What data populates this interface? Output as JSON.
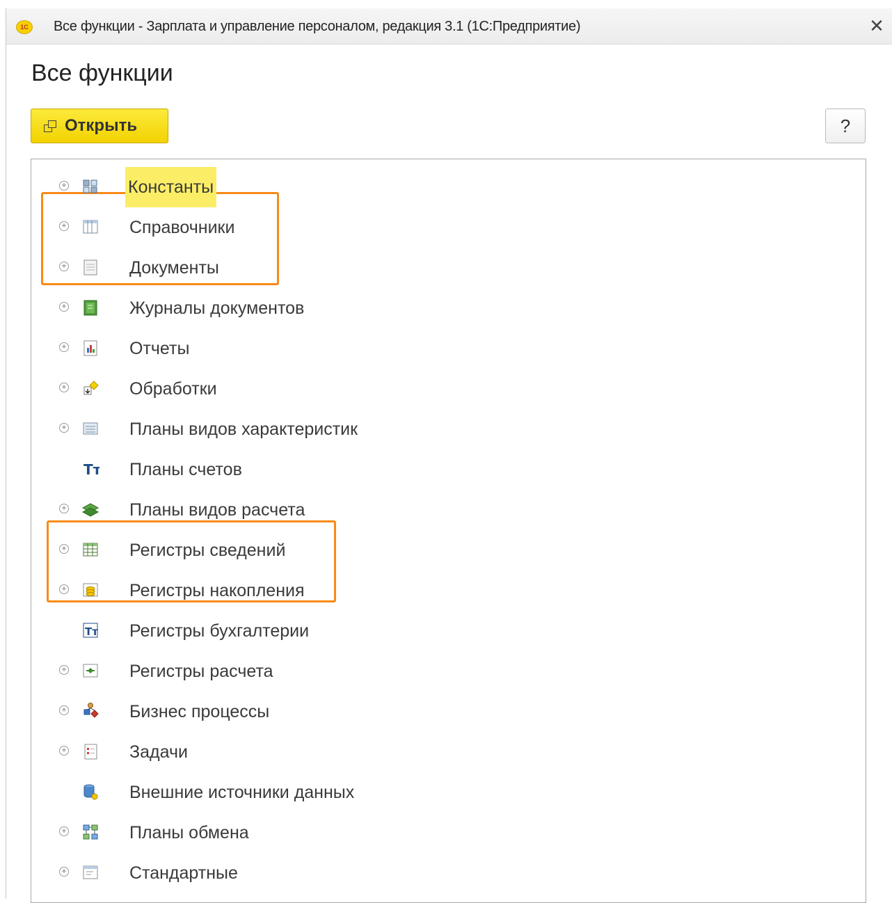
{
  "window": {
    "logo_text": "1С",
    "title": "Все функции - Зарплата и управление персоналом, редакция 3.1  (1С:Предприятие)",
    "close_label": "✕"
  },
  "page": {
    "title": "Все функции",
    "open_label": "Открыть",
    "help_label": "?"
  },
  "tree": {
    "items": [
      {
        "label": "Константы",
        "icon": "constants-icon",
        "expandable": true,
        "current": true
      },
      {
        "label": "Справочники",
        "icon": "catalogs-icon",
        "expandable": true
      },
      {
        "label": "Документы",
        "icon": "documents-icon",
        "expandable": true
      },
      {
        "label": "Журналы документов",
        "icon": "document-journals-icon",
        "expandable": true
      },
      {
        "label": "Отчеты",
        "icon": "reports-icon",
        "expandable": true
      },
      {
        "label": "Обработки",
        "icon": "data-processors-icon",
        "expandable": true
      },
      {
        "label": "Планы видов характеристик",
        "icon": "characteristic-types-icon",
        "expandable": true
      },
      {
        "label": "Планы счетов",
        "icon": "chart-of-accounts-icon",
        "expandable": false
      },
      {
        "label": "Планы видов расчета",
        "icon": "calculation-types-icon",
        "expandable": true
      },
      {
        "label": "Регистры сведений",
        "icon": "information-registers-icon",
        "expandable": true
      },
      {
        "label": "Регистры накопления",
        "icon": "accumulation-registers-icon",
        "expandable": true
      },
      {
        "label": "Регистры бухгалтерии",
        "icon": "accounting-registers-icon",
        "expandable": false
      },
      {
        "label": "Регистры расчета",
        "icon": "calculation-registers-icon",
        "expandable": true
      },
      {
        "label": "Бизнес процессы",
        "icon": "business-processes-icon",
        "expandable": true
      },
      {
        "label": "Задачи",
        "icon": "tasks-icon",
        "expandable": true
      },
      {
        "label": "Внешние источники данных",
        "icon": "external-data-sources-icon",
        "expandable": false
      },
      {
        "label": "Планы обмена",
        "icon": "exchange-plans-icon",
        "expandable": true
      },
      {
        "label": "Стандартные",
        "icon": "standard-icon",
        "expandable": true
      }
    ]
  },
  "colors": {
    "accent_yellow": "#f6dc1a",
    "highlight_yellow": "#fbee66",
    "annotation_orange": "#f98a18"
  }
}
